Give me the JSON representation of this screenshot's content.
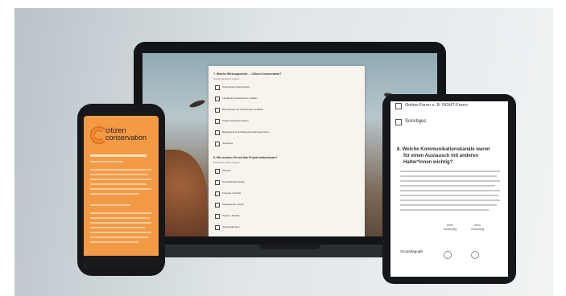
{
  "laptop_form": {
    "q1_title": "7. Welche Wirkungsweise ... Citizen Conservation?",
    "q1_sub": "Mehrfachauswahl möglich",
    "q1_options": [
      "Artenschutz direkt fördern",
      "Langfristig Populationen erhalten",
      "Bewusstsein für Artensterben schaffen",
      "Zusammenarbeit fördern",
      "Beteiligung an Erhaltungszuchtprogrammen",
      "Sonstiges"
    ],
    "q2_title": "8. Wie wurden Sie auf das Projekt aufmerksam?",
    "q2_sub": "Mehrfachauswahl möglich",
    "q2_options": [
      "Website",
      "Social-Media-Kanäle",
      "Freunde / Familie",
      "Zoologischer Garten",
      "Presse / Medien",
      "Veranstaltungen"
    ]
  },
  "phone": {
    "logo_line1": "citizen",
    "logo_line2": "conservation"
  },
  "tablet": {
    "prev_option": "Online-Foren z. B. DGHT-Foren",
    "other_option": "Sonstiges",
    "question": "8. Welche Kommunikationskanäle waren für einen Austausch mit anderen Halter*innen wichtig?",
    "question_lines": [
      "8. Welche Kommunikationskanäle waren",
      "für einen Austausch mit anderen",
      "Halter*innen wichtig?"
    ],
    "scale_left": "eher unwichtig",
    "scale_right": "eher unwichtig",
    "row_label": "Zoopädagogik"
  },
  "colors": {
    "phone_orange": "#f39a45",
    "device_frame": "#15171a"
  }
}
